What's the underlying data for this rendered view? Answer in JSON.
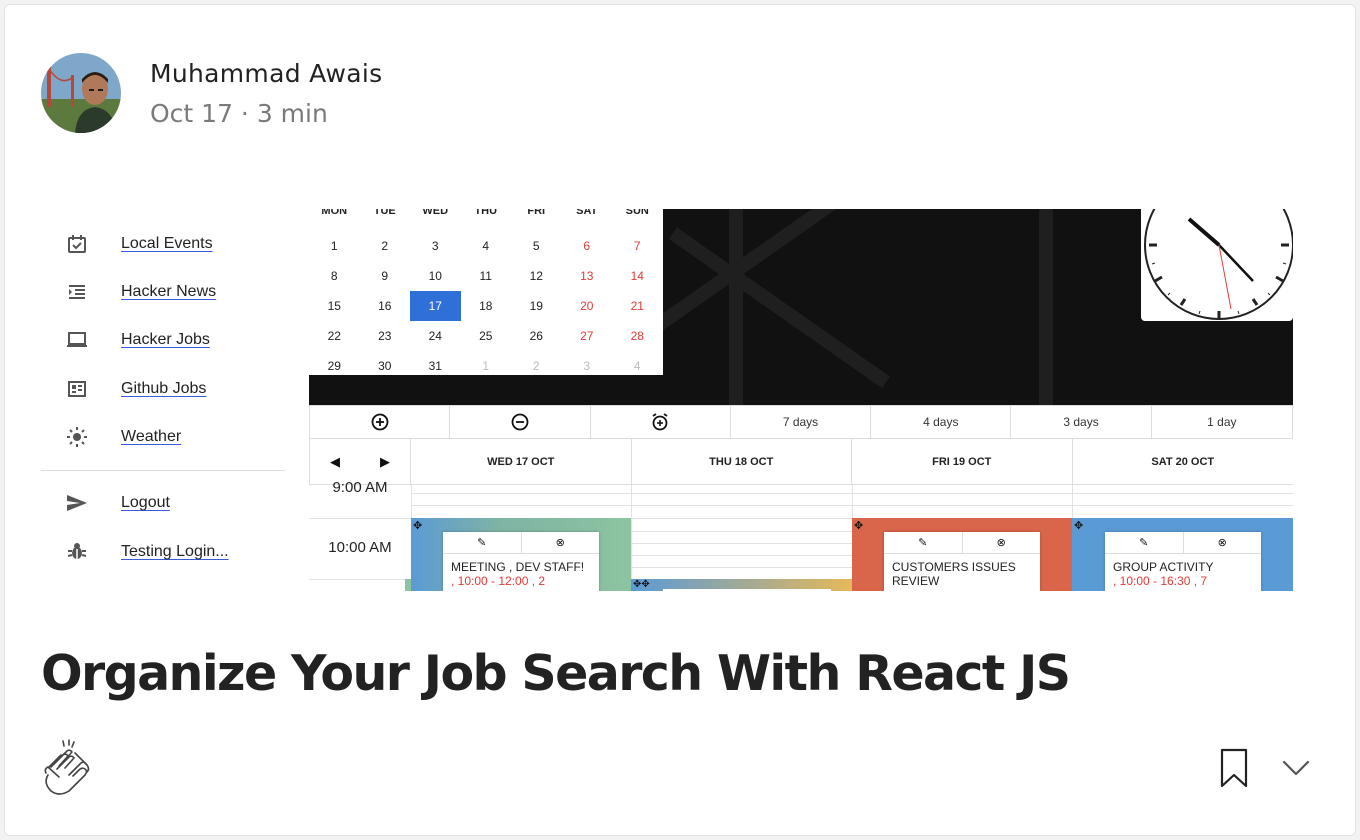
{
  "author": {
    "name": "Muhammad Awais",
    "date": "Oct 17",
    "read_time": "3 min",
    "separator": " · "
  },
  "article": {
    "title": "Organize Your Job Search With React JS"
  },
  "preview": {
    "nav": [
      {
        "label": "Local Events",
        "icon": "calendar-check-icon"
      },
      {
        "label": "Hacker News",
        "icon": "list-indent-icon"
      },
      {
        "label": "Hacker Jobs",
        "icon": "laptop-icon"
      },
      {
        "label": "Github Jobs",
        "icon": "document-grid-icon"
      },
      {
        "label": "Weather",
        "icon": "sun-icon"
      },
      {
        "label": "Logout",
        "icon": "send-icon"
      },
      {
        "label": "Testing Login...",
        "icon": "bug-icon"
      }
    ],
    "calendar": {
      "weekdays": [
        "MON",
        "TUE",
        "WED",
        "THU",
        "FRI",
        "SAT",
        "SUN"
      ],
      "selected_day": "17",
      "weeks": [
        [
          "1",
          "2",
          "3",
          "4",
          "5",
          "6",
          "7"
        ],
        [
          "8",
          "9",
          "10",
          "11",
          "12",
          "13",
          "14"
        ],
        [
          "15",
          "16",
          "17",
          "18",
          "19",
          "20",
          "21"
        ],
        [
          "22",
          "23",
          "24",
          "25",
          "26",
          "27",
          "28"
        ],
        [
          "29",
          "30",
          "31",
          "1",
          "2",
          "3",
          "4"
        ]
      ]
    },
    "toolbar": {
      "zoom_in_icon": "plus-circle-icon",
      "zoom_out_icon": "minus-circle-icon",
      "alarm_icon": "alarm-icon",
      "views": [
        "7 days",
        "4 days",
        "3 days",
        "1 day"
      ]
    },
    "nav_arrows": {
      "prev": "◀",
      "next": "▶"
    },
    "days": [
      "WED 17 OCT",
      "THU 18 OCT",
      "FRI 19 OCT",
      "SAT 20 OCT"
    ],
    "times": [
      "9:00 AM",
      "10:00 AM"
    ],
    "events": [
      {
        "title": "MEETING , DEV STAFF!",
        "detail": ", 10:00 - 12:00 , 2",
        "color": "#8dc4a0",
        "color2": "#6bbf8a"
      },
      {
        "title": "CUSTOMERS ISSUES REVIEW",
        "detail": "",
        "color": "#d9664a"
      },
      {
        "title": "GROUP ACTIVITY",
        "detail": ", 10:00 - 16:30 , 7",
        "color": "#5b9bd5"
      }
    ],
    "popup_icons": {
      "edit": "✎",
      "close": "⊗"
    }
  },
  "actions": {
    "clap_icon": "clap-icon",
    "bookmark_icon": "bookmark-icon",
    "more_icon": "chevron-down-icon"
  }
}
